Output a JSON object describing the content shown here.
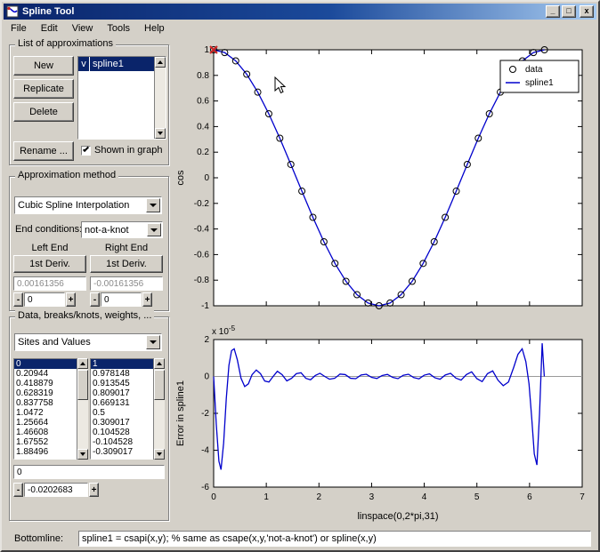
{
  "window": {
    "title": "Spline Tool",
    "min": "_",
    "max": "□",
    "close": "x"
  },
  "menu": {
    "items": [
      "File",
      "Edit",
      "View",
      "Tools",
      "Help"
    ]
  },
  "approx_list": {
    "legend": "List of approximations",
    "new": "New",
    "replicate": "Replicate",
    "delete": "Delete",
    "rename": "Rename ...",
    "items": [
      {
        "check": "v",
        "name": "spline1"
      }
    ],
    "shown_label": "Shown in graph"
  },
  "method": {
    "legend": "Approximation method",
    "method_value": "Cubic Spline Interpolation",
    "end_conditions_label": "End conditions:",
    "end_conditions_value": "not-a-knot",
    "left_end_label": "Left End",
    "right_end_label": "Right End",
    "left_deriv_button": "1st Deriv.",
    "right_deriv_button": "1st Deriv.",
    "left_deriv_value": "0.00161356",
    "right_deriv_value": "-0.00161356",
    "left_spin": "0",
    "right_spin": "0",
    "minus": "-",
    "plus": "+"
  },
  "data_panel": {
    "legend": "Data, breaks/knots, weights, ...",
    "view_value": "Sites and Values",
    "sites": [
      "0",
      "0.20944",
      "0.418879",
      "0.628319",
      "0.837758",
      "1.0472",
      "1.25664",
      "1.46608",
      "1.67552",
      "1.88496"
    ],
    "values": [
      "1",
      "0.978148",
      "0.913545",
      "0.809017",
      "0.669131",
      "0.5",
      "0.309017",
      "0.104528",
      "-0.104528",
      "-0.309017"
    ],
    "edit_value": "0",
    "spin_value": "-0.0202683",
    "minus": "-",
    "plus": "+"
  },
  "bottomline": {
    "label": "Bottomline:",
    "code": "spline1 = csapi(x,y); % same as csape(x,y,'not-a-knot') or spline(x,y)"
  },
  "chart_data": [
    {
      "type": "line+scatter",
      "title": "",
      "ylabel": "cos",
      "xlim": [
        0,
        7
      ],
      "ylim": [
        -1,
        1
      ],
      "xticks": [
        0,
        1,
        2,
        3,
        4,
        5,
        6,
        7
      ],
      "yticks": [
        -1,
        -0.8,
        -0.6,
        -0.4,
        -0.2,
        0,
        0.2,
        0.4,
        0.6,
        0.8,
        1
      ],
      "show_xtick_labels": false,
      "line_color": "#0000cc",
      "markers": "circle",
      "legend": [
        {
          "label": "data",
          "glyph": "circle",
          "color": "#000000"
        },
        {
          "label": "spline1",
          "glyph": "line",
          "color": "#0000cc"
        }
      ],
      "highlight": {
        "x": 0,
        "y": 1,
        "color": "#cc2222"
      },
      "x": [
        0,
        0.20944,
        0.41888,
        0.62832,
        0.83776,
        1.0472,
        1.25664,
        1.46608,
        1.67552,
        1.88496,
        2.0944,
        2.30383,
        2.51327,
        2.72271,
        2.93215,
        3.14159,
        3.35103,
        3.56047,
        3.76991,
        3.97935,
        4.18879,
        4.39823,
        4.60767,
        4.81711,
        5.02655,
        5.23599,
        5.44543,
        5.65487,
        5.86431,
        6.07375,
        6.28319
      ],
      "y": [
        1,
        0.978148,
        0.913545,
        0.809017,
        0.669131,
        0.5,
        0.309017,
        0.104528,
        -0.104528,
        -0.309017,
        -0.5,
        -0.669131,
        -0.809017,
        -0.913545,
        -0.978148,
        -1,
        -0.978148,
        -0.913545,
        -0.809017,
        -0.669131,
        -0.5,
        -0.309017,
        -0.104528,
        0.104528,
        0.309017,
        0.5,
        0.669131,
        0.809017,
        0.913545,
        0.978148,
        1
      ]
    },
    {
      "type": "line",
      "ylabel": "Error in spline1",
      "xlabel": "linspace(0,2*pi,31)",
      "scale_base": "x 10",
      "scale_exp": "-5",
      "xlim": [
        0,
        7
      ],
      "ylim": [
        -6,
        2
      ],
      "xticks": [
        0,
        1,
        2,
        3,
        4,
        5,
        6,
        7
      ],
      "yticks": [
        -6,
        -4,
        -2,
        0,
        2
      ],
      "show_xtick_labels": true,
      "zero_line": true,
      "line_color": "#0000cc",
      "x": [
        0,
        0.05,
        0.1,
        0.14,
        0.19,
        0.24,
        0.29,
        0.34,
        0.39,
        0.45,
        0.52,
        0.59,
        0.66,
        0.73,
        0.81,
        0.89,
        0.97,
        1.05,
        1.13,
        1.21,
        1.3,
        1.39,
        1.48,
        1.57,
        1.66,
        1.75,
        1.84,
        1.93,
        2.02,
        2.11,
        2.2,
        2.3,
        2.4,
        2.5,
        2.6,
        2.7,
        2.8,
        2.9,
        3.0,
        3.1,
        3.2,
        3.3,
        3.4,
        3.5,
        3.6,
        3.7,
        3.8,
        3.9,
        4.0,
        4.1,
        4.2,
        4.3,
        4.4,
        4.5,
        4.6,
        4.7,
        4.8,
        4.9,
        5.0,
        5.1,
        5.2,
        5.3,
        5.4,
        5.5,
        5.6,
        5.7,
        5.78,
        5.86,
        5.93,
        5.99,
        6.04,
        6.09,
        6.14,
        6.19,
        6.24,
        6.28
      ],
      "y": [
        0,
        -2.6,
        -4.6,
        -5.05,
        -3.6,
        -1.2,
        0.6,
        1.4,
        1.5,
        0.9,
        -0.1,
        -0.55,
        -0.4,
        0.1,
        0.35,
        0.15,
        -0.25,
        -0.3,
        0.0,
        0.28,
        0.1,
        -0.24,
        -0.1,
        0.15,
        0.2,
        -0.1,
        -0.18,
        0.05,
        0.17,
        0.0,
        -0.15,
        -0.1,
        0.13,
        0.1,
        -0.1,
        -0.12,
        0.08,
        0.12,
        -0.05,
        -0.11,
        0.05,
        0.11,
        -0.05,
        -0.12,
        0.06,
        0.12,
        -0.06,
        -0.13,
        0.07,
        0.14,
        -0.07,
        -0.15,
        0.08,
        0.17,
        -0.09,
        -0.2,
        0.1,
        0.25,
        -0.12,
        -0.28,
        0.15,
        0.3,
        -0.2,
        -0.5,
        -0.3,
        0.5,
        1.2,
        1.5,
        0.8,
        -0.4,
        -2.2,
        -4.2,
        -4.8,
        -2.0,
        1.8,
        0.0
      ]
    }
  ]
}
